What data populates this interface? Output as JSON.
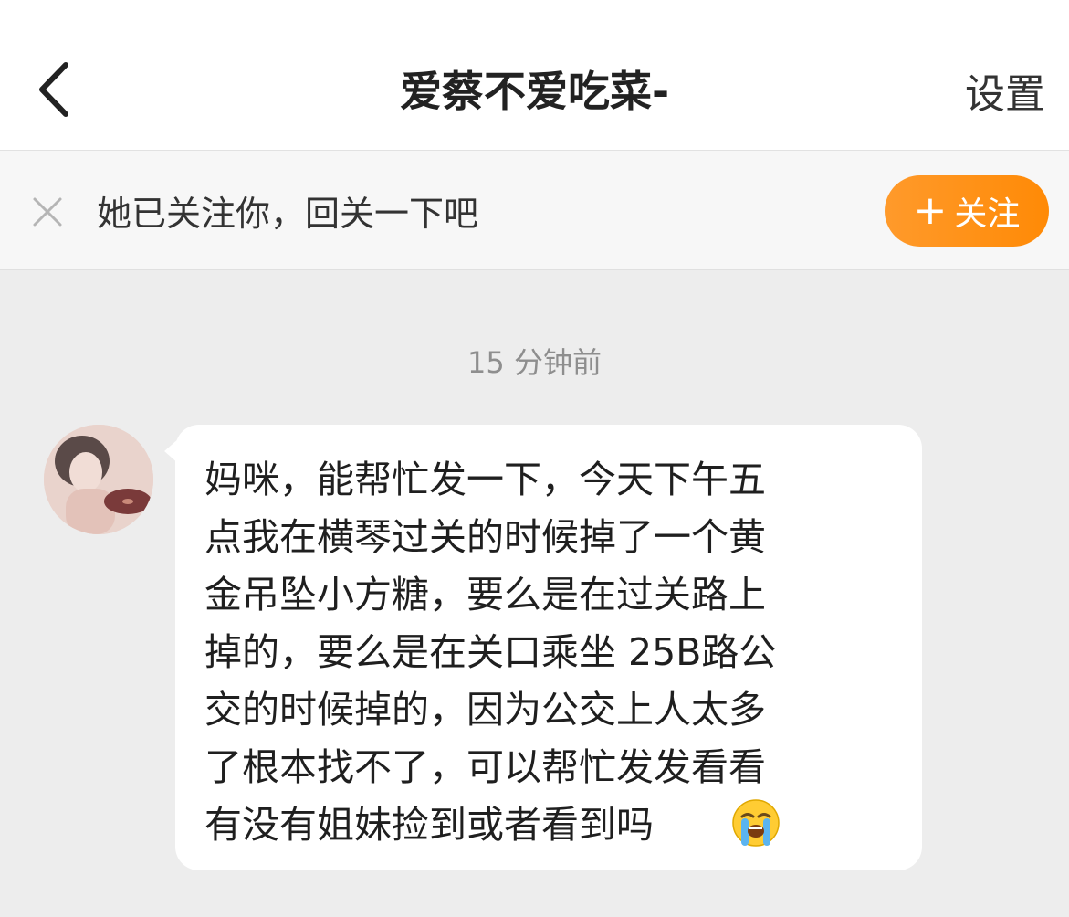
{
  "header": {
    "title": "爱蔡不爱吃菜-",
    "settings_label": "设置"
  },
  "follow_bar": {
    "text": "她已关注你，回关一下吧",
    "follow_button_plus": "+",
    "follow_button_label": "关注"
  },
  "chat": {
    "timestamp": "15 分钟前",
    "message_lines": [
      "妈咪，能帮忙发一下，今天下午五",
      "点我在横琴过关的时候掉了一个黄",
      "金吊坠小方糖，要么是在过关路上",
      "掉的，要么是在关口乘坐 25B路公",
      "交的时候掉的，因为公交上人太多",
      "了根本找不了，可以帮忙发发看看",
      "有没有姐妹捡到或者看到吗"
    ],
    "message_emoji": "loudly-crying-face"
  },
  "colors": {
    "accent": "#ff8a06",
    "background": "#ededed",
    "bubble": "#ffffff"
  }
}
